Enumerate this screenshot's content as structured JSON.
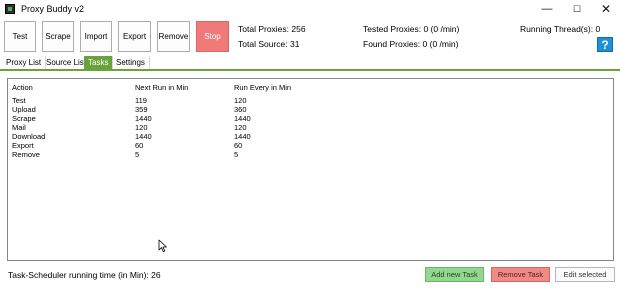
{
  "window": {
    "title": "Proxy Buddy v2",
    "controls": {
      "minimize": "—",
      "maximize": "☐",
      "close": "✕"
    }
  },
  "toolbar": {
    "test": "Test",
    "scrape": "Scrape",
    "import": "Import",
    "export": "Export",
    "remove": "Remove",
    "stop": "Stop"
  },
  "stats": {
    "total_proxies": "Total Proxies: 256",
    "total_source": "Total Source: 31",
    "tested_proxies": "Tested Proxies: 0 (0 /min)",
    "found_proxies": "Found Proxies: 0 (0 /min)",
    "running_threads": "Running Thread(s): 0"
  },
  "help": {
    "label": "?",
    "icon": "help-icon"
  },
  "tabs": [
    {
      "label": "Proxy List"
    },
    {
      "label": "Source List"
    },
    {
      "label": "Tasks"
    },
    {
      "label": "Settings"
    }
  ],
  "tasks_table": {
    "columns": [
      "Action",
      "Next Run in Min",
      "Run Every in Min"
    ],
    "rows": [
      {
        "action": "Test",
        "next": "119",
        "every": "120"
      },
      {
        "action": "Upload",
        "next": "359",
        "every": "360"
      },
      {
        "action": "Scrape",
        "next": "1440",
        "every": "1440"
      },
      {
        "action": "Mail",
        "next": "120",
        "every": "120"
      },
      {
        "action": "Download",
        "next": "1440",
        "every": "1440"
      },
      {
        "action": "Export",
        "next": "60",
        "every": "60"
      },
      {
        "action": "Remove",
        "next": "5",
        "every": "5"
      }
    ]
  },
  "status": {
    "scheduler_runtime": "Task-Scheduler running time (in Min): 26"
  },
  "actions": {
    "add_task": "Add new Task",
    "remove_task": "Remove Task",
    "edit_selected": "Edit selected"
  },
  "colors": {
    "accent_green": "#6aa33b",
    "stop_red": "#f07a7a",
    "add_green": "#93d690",
    "remove_red": "#ef8a86",
    "help_blue": "#1e90d6"
  }
}
